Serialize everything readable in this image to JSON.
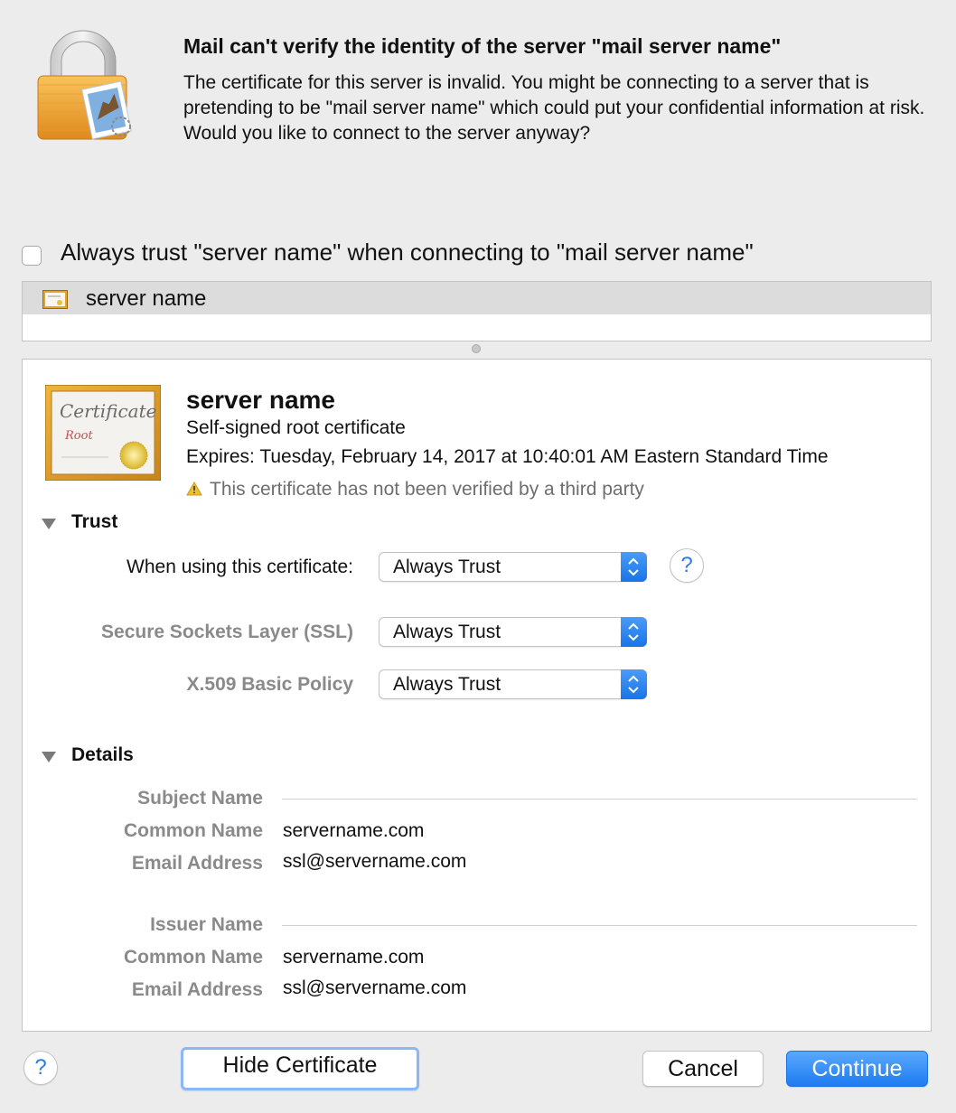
{
  "header": {
    "title": "Mail can't verify the identity of the server \"mail server name\"",
    "message": "The certificate for this server is invalid. You might be connecting to a server that is pretending to be \"mail server name\" which could put your confidential information at risk. Would you like to connect to the server anyway?",
    "icon": "lock-mail-icon"
  },
  "always_trust": {
    "checked": false,
    "label": "Always trust \"server name\" when connecting to \"mail server name\""
  },
  "cert_list": {
    "items": [
      {
        "label": "server name",
        "icon": "certificate-icon",
        "selected": true
      }
    ]
  },
  "certificate": {
    "name": "server name",
    "type": "Self-signed root certificate",
    "expires": "Expires: Tuesday, February 14, 2017 at 10:40:01 AM Eastern Standard Time",
    "warning": "This certificate has not been verified by a third party",
    "icon_text": "Certificate",
    "icon_subtext": "Root"
  },
  "trust": {
    "section_title": "Trust",
    "expanded": true,
    "rows": [
      {
        "label": "When using this certificate:",
        "value": "Always Trust"
      },
      {
        "label": "Secure Sockets Layer (SSL)",
        "value": "Always Trust"
      },
      {
        "label": "X.509 Basic Policy",
        "value": "Always Trust"
      }
    ],
    "help": "?"
  },
  "details": {
    "section_title": "Details",
    "expanded": true,
    "subject": {
      "heading": "Subject Name",
      "common_name_label": "Common Name",
      "common_name": "servername.com",
      "email_label": "Email Address",
      "email": "ssl@servername.com"
    },
    "issuer": {
      "heading": "Issuer Name",
      "common_name_label": "Common Name",
      "common_name": "servername.com",
      "email_label": "Email Address",
      "email": "ssl@servername.com"
    }
  },
  "buttons": {
    "help": "?",
    "hide_certificate": "Hide Certificate",
    "cancel": "Cancel",
    "continue": "Continue"
  },
  "colors": {
    "accent": "#1d7cf2",
    "window_bg": "#ececec",
    "dim_text": "#8a8a8a"
  }
}
